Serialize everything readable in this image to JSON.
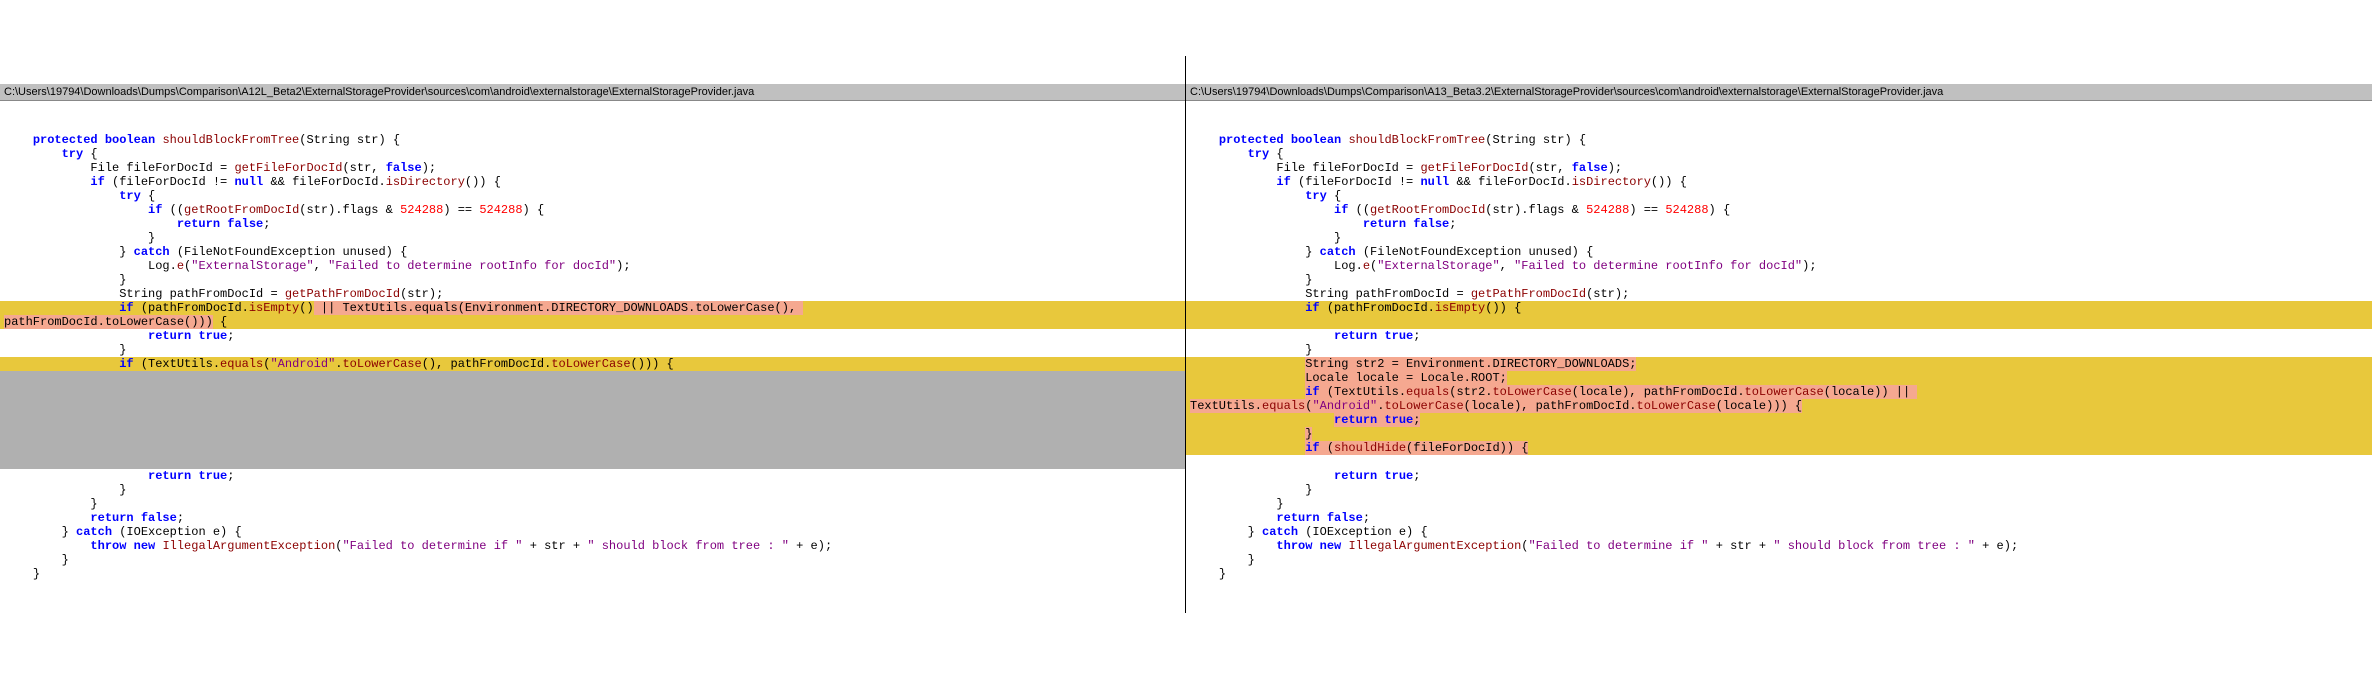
{
  "left": {
    "path": "C:\\Users\\19794\\Downloads\\Dumps\\Comparison\\A12L_Beta2\\ExternalStorageProvider\\sources\\com\\android\\externalstorage\\ExternalStorageProvider.java",
    "lines": [
      {
        "indent": 1,
        "bg": "",
        "segs": [
          {
            "t": "protected boolean",
            "c": "kw"
          },
          {
            "t": " "
          },
          {
            "t": "shouldBlockFromTree",
            "c": "method"
          },
          {
            "t": "(String str) {"
          }
        ]
      },
      {
        "indent": 2,
        "bg": "",
        "segs": [
          {
            "t": "try",
            "c": "kw"
          },
          {
            "t": " {"
          }
        ]
      },
      {
        "indent": 3,
        "bg": "",
        "segs": [
          {
            "t": "File fileForDocId = "
          },
          {
            "t": "getFileForDocId",
            "c": "method"
          },
          {
            "t": "(str, "
          },
          {
            "t": "false",
            "c": "kw"
          },
          {
            "t": ");"
          }
        ]
      },
      {
        "indent": 3,
        "bg": "",
        "segs": [
          {
            "t": "if",
            "c": "kw"
          },
          {
            "t": " (fileForDocId != "
          },
          {
            "t": "null",
            "c": "kw"
          },
          {
            "t": " && fileForDocId."
          },
          {
            "t": "isDirectory",
            "c": "method"
          },
          {
            "t": "()) {"
          }
        ]
      },
      {
        "indent": 4,
        "bg": "",
        "segs": [
          {
            "t": "try",
            "c": "kw"
          },
          {
            "t": " {"
          }
        ]
      },
      {
        "indent": 5,
        "bg": "",
        "segs": [
          {
            "t": "if",
            "c": "kw"
          },
          {
            "t": " (("
          },
          {
            "t": "getRootFromDocId",
            "c": "method"
          },
          {
            "t": "(str).flags & "
          },
          {
            "t": "524288",
            "c": "num"
          },
          {
            "t": ") == "
          },
          {
            "t": "524288",
            "c": "num"
          },
          {
            "t": ") {"
          }
        ]
      },
      {
        "indent": 6,
        "bg": "",
        "segs": [
          {
            "t": "return false",
            "c": "kw"
          },
          {
            "t": ";"
          }
        ]
      },
      {
        "indent": 5,
        "bg": "",
        "segs": [
          {
            "t": "}"
          }
        ]
      },
      {
        "indent": 4,
        "bg": "",
        "segs": [
          {
            "t": "} "
          },
          {
            "t": "catch",
            "c": "kw"
          },
          {
            "t": " (FileNotFoundException unused) {"
          }
        ]
      },
      {
        "indent": 5,
        "bg": "",
        "segs": [
          {
            "t": "Log."
          },
          {
            "t": "e",
            "c": "method"
          },
          {
            "t": "("
          },
          {
            "t": "\"ExternalStorage\"",
            "c": "str"
          },
          {
            "t": ", "
          },
          {
            "t": "\"Failed to determine rootInfo for docId\"",
            "c": "str"
          },
          {
            "t": ");"
          }
        ]
      },
      {
        "indent": 4,
        "bg": "",
        "segs": [
          {
            "t": "}"
          }
        ]
      },
      {
        "indent": 4,
        "bg": "",
        "segs": [
          {
            "t": "String pathFromDocId = "
          },
          {
            "t": "getPathFromDocId",
            "c": "method"
          },
          {
            "t": "(str);"
          }
        ]
      },
      {
        "indent": 4,
        "bg": "yellow",
        "segs": [
          {
            "t": "if",
            "c": "kw"
          },
          {
            "t": " (pathFromDocId."
          },
          {
            "t": "isEmpty",
            "c": "method"
          },
          {
            "t": "()"
          },
          {
            "t": " || TextUtils.equals(Environment.DIRECTORY_DOWNLOADS.toLowerCase(), ",
            "c": "",
            "mk": "salmon"
          }
        ]
      },
      {
        "indent": 0,
        "bg": "yellow",
        "segs": [
          {
            "t": "pathFromDocId.toLowerCase()))",
            "mk": "salmon"
          },
          {
            "t": " {"
          }
        ]
      },
      {
        "indent": 5,
        "bg": "",
        "segs": [
          {
            "t": "return true",
            "c": "kw"
          },
          {
            "t": ";"
          }
        ]
      },
      {
        "indent": 4,
        "bg": "",
        "segs": [
          {
            "t": "}"
          }
        ]
      },
      {
        "indent": 4,
        "bg": "yellow",
        "segs": [
          {
            "t": "if",
            "c": "kw"
          },
          {
            "t": " (TextUtils."
          },
          {
            "t": "equals",
            "c": "method"
          },
          {
            "t": "("
          },
          {
            "t": "\"Android\"",
            "c": "str"
          },
          {
            "t": "."
          },
          {
            "t": "toLowerCase",
            "c": "method"
          },
          {
            "t": "(), pathFromDocId."
          },
          {
            "t": "toLowerCase",
            "c": "method"
          },
          {
            "t": "())) {"
          }
        ]
      },
      {
        "indent": 0,
        "bg": "gray",
        "segs": [
          {
            "t": " "
          }
        ]
      },
      {
        "indent": 0,
        "bg": "gray",
        "segs": [
          {
            "t": " "
          }
        ]
      },
      {
        "indent": 0,
        "bg": "gray",
        "segs": [
          {
            "t": " "
          }
        ]
      },
      {
        "indent": 0,
        "bg": "gray",
        "segs": [
          {
            "t": " "
          }
        ]
      },
      {
        "indent": 0,
        "bg": "gray",
        "segs": [
          {
            "t": " "
          }
        ]
      },
      {
        "indent": 0,
        "bg": "gray",
        "segs": [
          {
            "t": " "
          }
        ]
      },
      {
        "indent": 0,
        "bg": "gray",
        "segs": [
          {
            "t": " "
          }
        ]
      },
      {
        "indent": 5,
        "bg": "",
        "segs": [
          {
            "t": "return true",
            "c": "kw"
          },
          {
            "t": ";"
          }
        ]
      },
      {
        "indent": 4,
        "bg": "",
        "segs": [
          {
            "t": "}"
          }
        ]
      },
      {
        "indent": 3,
        "bg": "",
        "segs": [
          {
            "t": "}"
          }
        ]
      },
      {
        "indent": 3,
        "bg": "",
        "segs": [
          {
            "t": "return false",
            "c": "kw"
          },
          {
            "t": ";"
          }
        ]
      },
      {
        "indent": 2,
        "bg": "",
        "segs": [
          {
            "t": "} "
          },
          {
            "t": "catch",
            "c": "kw"
          },
          {
            "t": " (IOException e) {"
          }
        ]
      },
      {
        "indent": 3,
        "bg": "",
        "segs": [
          {
            "t": "throw new",
            "c": "kw"
          },
          {
            "t": " "
          },
          {
            "t": "IllegalArgumentException",
            "c": "method"
          },
          {
            "t": "("
          },
          {
            "t": "\"Failed to determine if \"",
            "c": "str"
          },
          {
            "t": " + str + "
          },
          {
            "t": "\" should block from tree : \"",
            "c": "str"
          },
          {
            "t": " + e);"
          }
        ]
      },
      {
        "indent": 2,
        "bg": "",
        "segs": [
          {
            "t": "}"
          }
        ]
      },
      {
        "indent": 1,
        "bg": "",
        "segs": [
          {
            "t": "}"
          }
        ]
      }
    ]
  },
  "right": {
    "path": "C:\\Users\\19794\\Downloads\\Dumps\\Comparison\\A13_Beta3.2\\ExternalStorageProvider\\sources\\com\\android\\externalstorage\\ExternalStorageProvider.java",
    "lines": [
      {
        "indent": 1,
        "bg": "",
        "segs": [
          {
            "t": "protected boolean",
            "c": "kw"
          },
          {
            "t": " "
          },
          {
            "t": "shouldBlockFromTree",
            "c": "method"
          },
          {
            "t": "(String str) {"
          }
        ]
      },
      {
        "indent": 2,
        "bg": "",
        "segs": [
          {
            "t": "try",
            "c": "kw"
          },
          {
            "t": " {"
          }
        ]
      },
      {
        "indent": 3,
        "bg": "",
        "segs": [
          {
            "t": "File fileForDocId = "
          },
          {
            "t": "getFileForDocId",
            "c": "method"
          },
          {
            "t": "(str, "
          },
          {
            "t": "false",
            "c": "kw"
          },
          {
            "t": ");"
          }
        ]
      },
      {
        "indent": 3,
        "bg": "",
        "segs": [
          {
            "t": "if",
            "c": "kw"
          },
          {
            "t": " (fileForDocId != "
          },
          {
            "t": "null",
            "c": "kw"
          },
          {
            "t": " && fileForDocId."
          },
          {
            "t": "isDirectory",
            "c": "method"
          },
          {
            "t": "()) {"
          }
        ]
      },
      {
        "indent": 4,
        "bg": "",
        "segs": [
          {
            "t": "try",
            "c": "kw"
          },
          {
            "t": " {"
          }
        ]
      },
      {
        "indent": 5,
        "bg": "",
        "segs": [
          {
            "t": "if",
            "c": "kw"
          },
          {
            "t": " (("
          },
          {
            "t": "getRootFromDocId",
            "c": "method"
          },
          {
            "t": "(str).flags & "
          },
          {
            "t": "524288",
            "c": "num"
          },
          {
            "t": ") == "
          },
          {
            "t": "524288",
            "c": "num"
          },
          {
            "t": ") {"
          }
        ]
      },
      {
        "indent": 6,
        "bg": "",
        "segs": [
          {
            "t": "return false",
            "c": "kw"
          },
          {
            "t": ";"
          }
        ]
      },
      {
        "indent": 5,
        "bg": "",
        "segs": [
          {
            "t": "}"
          }
        ]
      },
      {
        "indent": 4,
        "bg": "",
        "segs": [
          {
            "t": "} "
          },
          {
            "t": "catch",
            "c": "kw"
          },
          {
            "t": " (FileNotFoundException unused) {"
          }
        ]
      },
      {
        "indent": 5,
        "bg": "",
        "segs": [
          {
            "t": "Log."
          },
          {
            "t": "e",
            "c": "method"
          },
          {
            "t": "("
          },
          {
            "t": "\"ExternalStorage\"",
            "c": "str"
          },
          {
            "t": ", "
          },
          {
            "t": "\"Failed to determine rootInfo for docId\"",
            "c": "str"
          },
          {
            "t": ");"
          }
        ]
      },
      {
        "indent": 4,
        "bg": "",
        "segs": [
          {
            "t": "}"
          }
        ]
      },
      {
        "indent": 4,
        "bg": "",
        "segs": [
          {
            "t": "String pathFromDocId = "
          },
          {
            "t": "getPathFromDocId",
            "c": "method"
          },
          {
            "t": "(str);"
          }
        ]
      },
      {
        "indent": 4,
        "bg": "yellow",
        "segs": [
          {
            "t": "if",
            "c": "kw"
          },
          {
            "t": " (pathFromDocId."
          },
          {
            "t": "isEmpty",
            "c": "method"
          },
          {
            "t": "()) {"
          }
        ]
      },
      {
        "indent": 0,
        "bg": "yellow",
        "segs": [
          {
            "t": " "
          }
        ]
      },
      {
        "indent": 5,
        "bg": "",
        "segs": [
          {
            "t": "return true",
            "c": "kw"
          },
          {
            "t": ";"
          }
        ]
      },
      {
        "indent": 4,
        "bg": "",
        "segs": [
          {
            "t": "}"
          }
        ]
      },
      {
        "indent": 4,
        "bg": "yellow",
        "segs": [
          {
            "t": "String str2 = Environment.DIRECTORY_DOWNLOADS;",
            "mk": "salmon"
          }
        ]
      },
      {
        "indent": 4,
        "bg": "yellow",
        "segs": [
          {
            "t": "Locale locale = Locale.ROOT;",
            "mk": "salmon"
          }
        ]
      },
      {
        "indent": 4,
        "bg": "yellow",
        "segs": [
          {
            "t": "if",
            "c": "kw",
            "mk": "salmon"
          },
          {
            "t": " (TextUtils.",
            "mk": "salmon"
          },
          {
            "t": "equals",
            "c": "method",
            "mk": "salmon"
          },
          {
            "t": "(str2.",
            "mk": "salmon"
          },
          {
            "t": "toLowerCase",
            "c": "method",
            "mk": "salmon"
          },
          {
            "t": "(locale), pathFromDocId.",
            "mk": "salmon"
          },
          {
            "t": "toLowerCase",
            "c": "method",
            "mk": "salmon"
          },
          {
            "t": "(locale)) || ",
            "mk": "salmon"
          }
        ]
      },
      {
        "indent": 0,
        "bg": "yellow",
        "segs": [
          {
            "t": "TextUtils.",
            "mk": "salmon"
          },
          {
            "t": "equals",
            "c": "method",
            "mk": "salmon"
          },
          {
            "t": "(",
            "mk": "salmon"
          },
          {
            "t": "\"Android\"",
            "c": "str",
            "mk": "salmon"
          },
          {
            "t": ".",
            "mk": "salmon"
          },
          {
            "t": "toLowerCase",
            "c": "method",
            "mk": "salmon"
          },
          {
            "t": "(locale), pathFromDocId.",
            "mk": "salmon"
          },
          {
            "t": "toLowerCase",
            "c": "method",
            "mk": "salmon"
          },
          {
            "t": "(locale))) {",
            "mk": "salmon"
          }
        ]
      },
      {
        "indent": 5,
        "bg": "yellow",
        "segs": [
          {
            "t": "return true",
            "c": "kw",
            "mk": "salmon"
          },
          {
            "t": ";",
            "mk": "salmon"
          }
        ]
      },
      {
        "indent": 4,
        "bg": "yellow",
        "segs": [
          {
            "t": "}",
            "mk": "salmon"
          }
        ]
      },
      {
        "indent": 4,
        "bg": "yellow",
        "segs": [
          {
            "t": "if",
            "c": "kw",
            "mk": "salmon"
          },
          {
            "t": " (",
            "mk": "salmon"
          },
          {
            "t": "shouldHide",
            "c": "method",
            "mk": "salmon"
          },
          {
            "t": "(fileForDocId)) {",
            "mk": "salmon"
          }
        ]
      },
      {
        "indent": 0,
        "bg": "",
        "segs": [
          {
            "t": " "
          }
        ]
      },
      {
        "indent": 5,
        "bg": "",
        "segs": [
          {
            "t": "return true",
            "c": "kw"
          },
          {
            "t": ";"
          }
        ]
      },
      {
        "indent": 4,
        "bg": "",
        "segs": [
          {
            "t": "}"
          }
        ]
      },
      {
        "indent": 3,
        "bg": "",
        "segs": [
          {
            "t": "}"
          }
        ]
      },
      {
        "indent": 3,
        "bg": "",
        "segs": [
          {
            "t": "return false",
            "c": "kw"
          },
          {
            "t": ";"
          }
        ]
      },
      {
        "indent": 2,
        "bg": "",
        "segs": [
          {
            "t": "} "
          },
          {
            "t": "catch",
            "c": "kw"
          },
          {
            "t": " (IOException e) {"
          }
        ]
      },
      {
        "indent": 3,
        "bg": "",
        "segs": [
          {
            "t": "throw new",
            "c": "kw"
          },
          {
            "t": " "
          },
          {
            "t": "IllegalArgumentException",
            "c": "method"
          },
          {
            "t": "("
          },
          {
            "t": "\"Failed to determine if \"",
            "c": "str"
          },
          {
            "t": " + str + "
          },
          {
            "t": "\" should block from tree : \"",
            "c": "str"
          },
          {
            "t": " + e);"
          }
        ]
      },
      {
        "indent": 2,
        "bg": "",
        "segs": [
          {
            "t": "}"
          }
        ]
      },
      {
        "indent": 1,
        "bg": "",
        "segs": [
          {
            "t": "}"
          }
        ]
      }
    ]
  }
}
